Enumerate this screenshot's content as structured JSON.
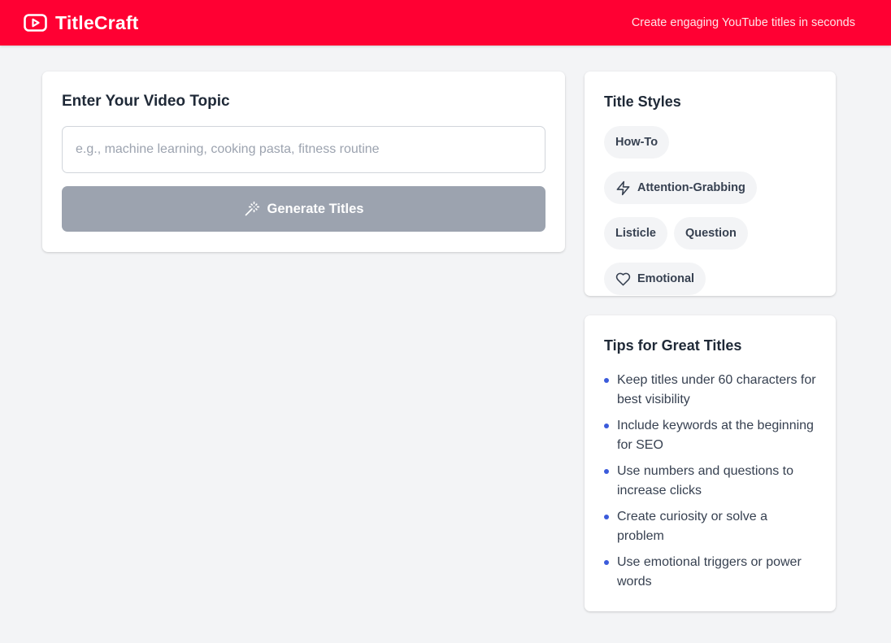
{
  "header": {
    "brand": "TitleCraft",
    "brand_icon": "play-square-icon",
    "tagline": "Create engaging YouTube titles in seconds",
    "background": "#ff0033"
  },
  "topic_card": {
    "heading": "Enter Your Video Topic",
    "input_value": "",
    "input_placeholder": "e.g., machine learning, cooking pasta, fitness routine",
    "generate_button": {
      "label": "Generate Titles",
      "icon": "magic-wand-icon",
      "state": "disabled",
      "color": "#9ca3af"
    }
  },
  "styles_card": {
    "heading": "Title Styles",
    "chips": [
      {
        "label": "How-To",
        "icon": ""
      },
      {
        "label": "Attention-Grabbing",
        "icon": "lightning-icon"
      },
      {
        "label": "Listicle",
        "icon": ""
      },
      {
        "label": "Question",
        "icon": ""
      },
      {
        "label": "Emotional",
        "icon": "heart-icon"
      }
    ]
  },
  "tips_card": {
    "heading": "Tips for Great Titles",
    "bullet_color": "#3b5bdb",
    "tips": [
      "Keep titles under 60 characters for best visibility",
      "Include keywords at the beginning for SEO",
      "Use numbers and questions to increase clicks",
      "Create curiosity or solve a problem",
      "Use emotional triggers or power words"
    ]
  }
}
